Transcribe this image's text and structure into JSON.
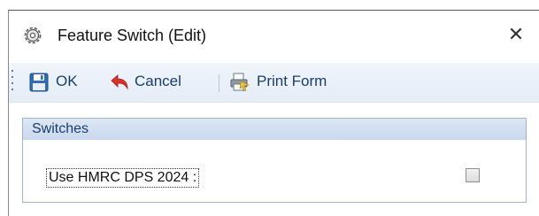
{
  "window": {
    "title": "Feature Switch (Edit)",
    "close_glyph": "✕",
    "icon": "gear-icon"
  },
  "toolbar": {
    "ok_label": "OK",
    "cancel_label": "Cancel",
    "print_label": "Print Form",
    "icons": [
      "save-icon",
      "undo-arrow-icon",
      "print-form-icon"
    ]
  },
  "switches": {
    "title": "Switches",
    "items": [
      {
        "label": "Use HMRC DPS 2024 :",
        "checked": false
      }
    ]
  },
  "colors": {
    "toolbar_text": "#1a3d6d",
    "group_header": "#c8d8ee",
    "cancel_arrow": "#d9342b"
  }
}
